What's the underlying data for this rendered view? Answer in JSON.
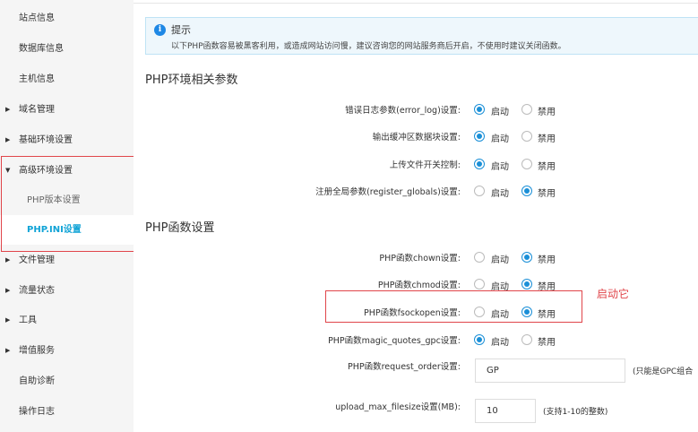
{
  "sidebar": {
    "items": [
      {
        "label": "站点信息"
      },
      {
        "label": "数据库信息"
      },
      {
        "label": "主机信息"
      },
      {
        "label": "域名管理"
      },
      {
        "label": "基础环境设置"
      },
      {
        "label": "高级环境设置"
      },
      {
        "label": "PHP版本设置"
      },
      {
        "label": "PHP.INI设置"
      },
      {
        "label": "文件管理"
      },
      {
        "label": "流量状态"
      },
      {
        "label": "工具"
      },
      {
        "label": "增值服务"
      },
      {
        "label": "自助诊断"
      },
      {
        "label": "操作日志"
      }
    ],
    "active": "PHP.INI设置"
  },
  "notice": {
    "icon": "info-icon",
    "icon_glyph": "i",
    "title": "提示",
    "text": "以下PHP函数容易被黑客利用，或造成网站访问慢，建议咨询您的网站服务商后开启，不使用时建议关闭函数。"
  },
  "radio_options": {
    "on": "启动",
    "off": "禁用"
  },
  "env_section": {
    "title": "PHP环境相关参数",
    "rows": [
      {
        "label": "错误日志参数(error_log)设置:",
        "selected": "on"
      },
      {
        "label": "输出缓冲区数据块设置:",
        "selected": "on"
      },
      {
        "label": "上传文件开关控制:",
        "selected": "on"
      },
      {
        "label": "注册全局参数(register_globals)设置:",
        "selected": "off"
      }
    ]
  },
  "func_section": {
    "title": "PHP函数设置",
    "rows": [
      {
        "label": "PHP函数chown设置:",
        "selected": "off"
      },
      {
        "label": "PHP函数chmod设置:",
        "selected": "off"
      },
      {
        "label": "PHP函数fsockopen设置:",
        "selected": "off"
      },
      {
        "label": "PHP函数magic_quotes_gpc设置:",
        "selected": "on"
      }
    ],
    "request_order": {
      "label": "PHP函数request_order设置:",
      "value": "GP",
      "hint": "(只能是GPC组合"
    },
    "upload_max": {
      "label": "upload_max_filesize设置(MB):",
      "value": "10",
      "hint": "(支持1-10的整数)"
    }
  },
  "annotation": {
    "text": "启动它",
    "color": "#e0454a"
  },
  "colors": {
    "accent": "#10a3d6",
    "radio": "#1a8fd7",
    "highlight": "#e0454a"
  }
}
